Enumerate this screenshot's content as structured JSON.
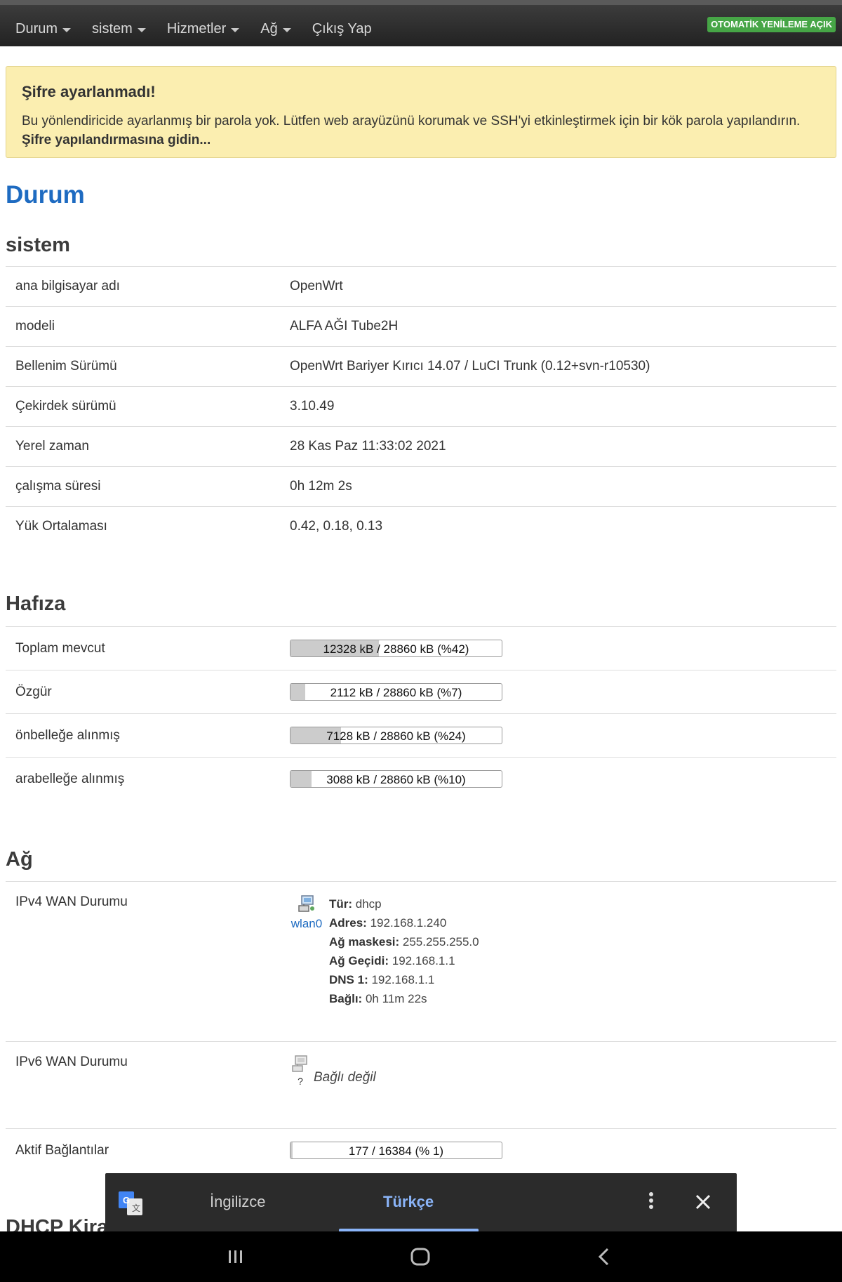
{
  "nav": {
    "items": [
      {
        "label": "Durum",
        "dropdown": true
      },
      {
        "label": "sistem",
        "dropdown": true
      },
      {
        "label": "Hizmetler",
        "dropdown": true
      },
      {
        "label": "Ağ",
        "dropdown": true
      },
      {
        "label": "Çıkış Yap",
        "dropdown": false
      }
    ],
    "auto_refresh": "OTOMATİK YENİLEME AÇIK"
  },
  "alert": {
    "title": "Şifre ayarlanmadı!",
    "message": "Bu yönlendiricide ayarlanmış bir parola yok. Lütfen web arayüzünü korumak ve SSH'yi etkinleştirmek için bir kök parola yapılandırın.",
    "link": "Şifre yapılandırmasına gidin..."
  },
  "page_title": "Durum",
  "system": {
    "title": "sistem",
    "rows": [
      {
        "label": "ana bilgisayar adı",
        "value": "OpenWrt"
      },
      {
        "label": "modeli",
        "value": "ALFA AĞI Tube2H"
      },
      {
        "label": "Bellenim Sürümü",
        "value": "OpenWrt Bariyer Kırıcı 14.07 / LuCI Trunk (0.12+svn-r10530)"
      },
      {
        "label": "Çekirdek sürümü",
        "value": "3.10.49"
      },
      {
        "label": "Yerel zaman",
        "value": "28 Kas Paz 11:33:02 2021"
      },
      {
        "label": "çalışma süresi",
        "value": "0h 12m 2s"
      },
      {
        "label": "Yük Ortalaması",
        "value": "0.42, 0.18, 0.13"
      }
    ]
  },
  "memory": {
    "title": "Hafıza",
    "rows": [
      {
        "label": "Toplam mevcut",
        "text": "12328 kB / 28860 kB (%42)",
        "percent": 42
      },
      {
        "label": "Özgür",
        "text": "2112 kB / 28860 kB (%7)",
        "percent": 7
      },
      {
        "label": "önbelleğe alınmış",
        "text": "7128 kB / 28860 kB (%24)",
        "percent": 24
      },
      {
        "label": "arabelleğe alınmış",
        "text": "3088 kB / 28860 kB (%10)",
        "percent": 10
      }
    ]
  },
  "network": {
    "title": "Ağ",
    "ipv4": {
      "label": "IPv4 WAN Durumu",
      "iface": "wlan0",
      "details": [
        {
          "key": "Tür:",
          "value": " dhcp"
        },
        {
          "key": "Adres:",
          "value": " 192.168.1.240"
        },
        {
          "key": "Ağ maskesi:",
          "value": " 255.255.255.0"
        },
        {
          "key": "Ağ Geçidi:",
          "value": " 192.168.1.1"
        },
        {
          "key": "DNS 1:",
          "value": " 192.168.1.1"
        },
        {
          "key": "Bağlı:",
          "value": " 0h 11m 22s"
        }
      ]
    },
    "ipv6": {
      "label": "IPv6 WAN Durumu",
      "iface": "?",
      "status": "Bağlı değil"
    },
    "connections": {
      "label": "Aktif Bağlantılar",
      "text": "177 / 16384 (% 1)",
      "percent": 1
    }
  },
  "next_section_partial": "DHCP Kiral",
  "translate_bar": {
    "source_lang": "İngilizce",
    "target_lang": "Türkçe"
  },
  "icons": {
    "translate": "google-translate-icon",
    "more": "more-vert-icon",
    "close": "close-icon",
    "recents": "recent-apps-icon",
    "home": "home-icon",
    "back": "back-icon"
  }
}
